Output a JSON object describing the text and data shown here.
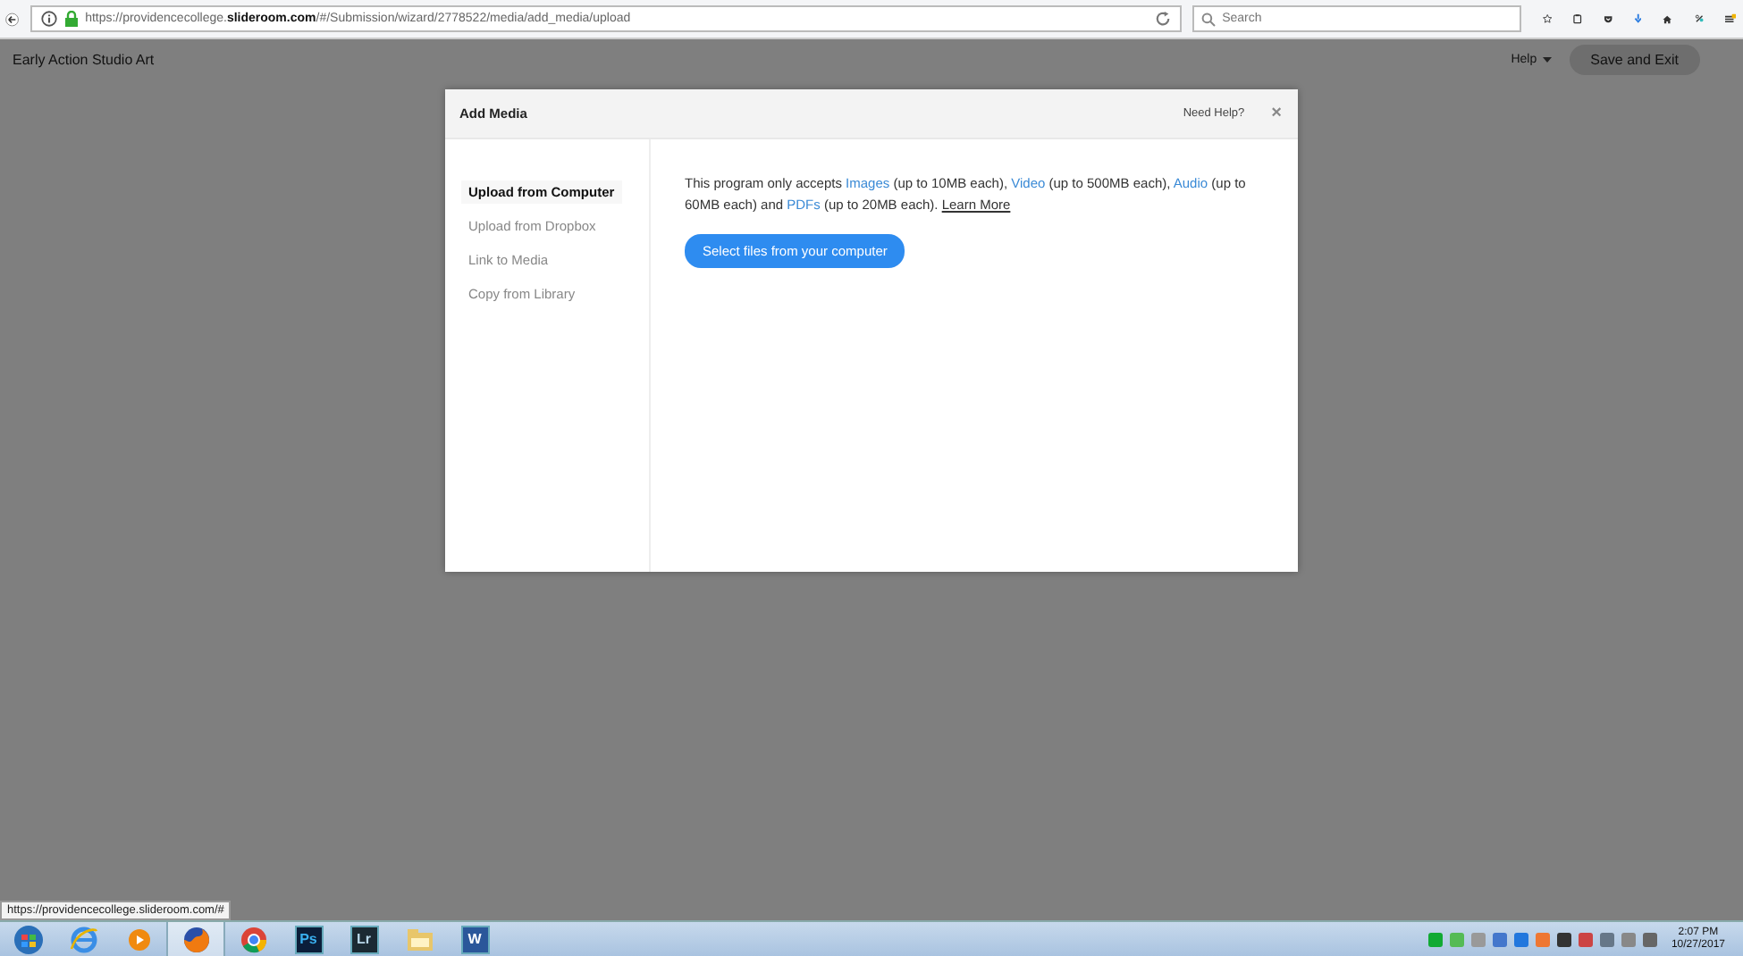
{
  "browser": {
    "url": "https://providencecollege.**slideroom.com**/#/Submission/wizard/2778522/media/add_media/upload",
    "search": {
      "placeholder": "Search"
    }
  },
  "page": {
    "title": "Early Action Studio Art",
    "help": "Help",
    "save_button": "Save and Exit"
  },
  "dialog": {
    "title": "Add Media",
    "need_help": "Need Help?",
    "close": "×",
    "nav": [
      {
        "label": "Upload from Computer",
        "selected": true
      },
      {
        "label": "Upload from Dropbox",
        "selected": false
      },
      {
        "label": "Link to Media",
        "selected": false
      },
      {
        "label": "Copy from Library",
        "selected": false
      }
    ],
    "message": [
      {
        "kind": "text",
        "text": "This program only accepts "
      },
      {
        "kind": "link",
        "text": "Images"
      },
      {
        "kind": "text",
        "text": " (up to 10MB each), "
      },
      {
        "kind": "link",
        "text": "Video"
      },
      {
        "kind": "text",
        "text": " (up to 500MB each), "
      },
      {
        "kind": "link",
        "text": "Audio"
      },
      {
        "kind": "text",
        "text": " (up to 60MB each) and "
      },
      {
        "kind": "link",
        "text": "PDFs"
      },
      {
        "kind": "text",
        "text": " (up to 20MB each). "
      },
      {
        "kind": "underline",
        "text": "Learn More"
      }
    ],
    "select_button": "Select files from your computer"
  },
  "status_tooltip": "https://providencecollege.slideroom.com/#",
  "taskbar": {
    "apps": [
      {
        "kind": "start",
        "active": false
      },
      {
        "kind": "ie",
        "active": false
      },
      {
        "kind": "player",
        "active": false
      },
      {
        "kind": "firefox",
        "active": true
      },
      {
        "kind": "chrome",
        "active": false
      },
      {
        "kind": "ps",
        "label": "Ps",
        "active": false
      },
      {
        "kind": "lr",
        "label": "Lr",
        "active": false
      },
      {
        "kind": "folder",
        "active": false
      },
      {
        "kind": "word",
        "label": "W",
        "active": false
      }
    ],
    "time": "2:07 PM",
    "date": "10/27/2017"
  }
}
